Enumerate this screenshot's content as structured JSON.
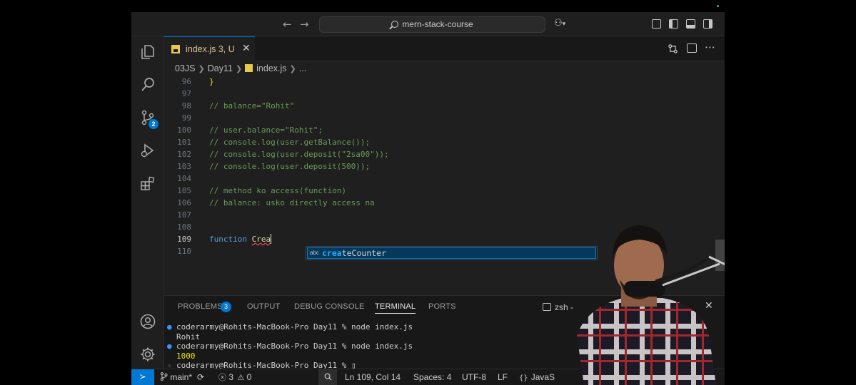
{
  "titlebar": {
    "back_arrow": "←",
    "forward_arrow": "→",
    "search_text": "mern-stack-course",
    "copilot_glyph": "⚇",
    "copilot_chevron": "▾"
  },
  "activity_bar": {
    "source_control_badge": "2"
  },
  "tab": {
    "label": "index.js 3, U",
    "close": "✕"
  },
  "breadcrumb": {
    "folder1": "03JS",
    "folder2": "Day11",
    "file": "index.js",
    "more": "..."
  },
  "editor": {
    "lines": [
      {
        "num": "96",
        "text": "}",
        "kind": "brace"
      },
      {
        "num": "97",
        "text": "",
        "kind": "plain"
      },
      {
        "num": "98",
        "text": "// balance=\"Rohit\"",
        "kind": "comment"
      },
      {
        "num": "99",
        "text": "",
        "kind": "plain"
      },
      {
        "num": "100",
        "text": "// user.balance=\"Rohit\";",
        "kind": "comment"
      },
      {
        "num": "101",
        "text": "// console.log(user.getBalance());",
        "kind": "comment"
      },
      {
        "num": "102",
        "text": "// console.log(user.deposit(\"2sa00\"));",
        "kind": "comment"
      },
      {
        "num": "103",
        "text": "// console.log(user.deposit(500));",
        "kind": "comment"
      },
      {
        "num": "104",
        "text": "",
        "kind": "plain"
      },
      {
        "num": "105",
        "text": "// method ko access(function)",
        "kind": "comment"
      },
      {
        "num": "106",
        "text": "// balance: usko directly access na",
        "kind": "comment"
      },
      {
        "num": "107",
        "text": "",
        "kind": "plain"
      },
      {
        "num": "108",
        "text": "",
        "kind": "plain"
      },
      {
        "num": "109",
        "text": "",
        "kind": "active"
      },
      {
        "num": "110",
        "text": "",
        "kind": "plain"
      }
    ],
    "active_line": {
      "keyword": "function",
      "typed": "Crea"
    },
    "suggestion": {
      "icon": "abc",
      "match": "crea",
      "rest": "teCounter"
    }
  },
  "panel": {
    "tabs": [
      "PROBLEMS",
      "OUTPUT",
      "DEBUG CONSOLE",
      "TERMINAL",
      "PORTS"
    ],
    "problems_count": "3",
    "shell": "zsh - ",
    "close": "✕",
    "terminal_lines": [
      {
        "prefix": "●",
        "text": "coderarmy@Rohits-MacBook-Pro Day11 % node index.js",
        "kind": "prompt"
      },
      {
        "prefix": "",
        "text": "Rohit",
        "kind": "output"
      },
      {
        "prefix": "●",
        "text": "coderarmy@Rohits-MacBook-Pro Day11 % node index.js",
        "kind": "prompt"
      },
      {
        "prefix": "",
        "text": "1000",
        "kind": "number"
      },
      {
        "prefix": "✧",
        "text": "coderarmy@Rohits-MacBook-Pro Day11 % ▯",
        "kind": "current"
      }
    ]
  },
  "status_bar": {
    "remote": "≻",
    "branch": "main*",
    "sync": "⟳",
    "errors": "3",
    "warnings": "0",
    "position": "Ln 109, Col 14",
    "spaces": "Spaces: 4",
    "encoding": "UTF-8",
    "eol": "LF",
    "language": "JavaS"
  },
  "colors": {
    "accent": "#0078d4",
    "comment": "#6a9955",
    "keyword": "#569cd6",
    "tab_label": "#e2c08d"
  }
}
